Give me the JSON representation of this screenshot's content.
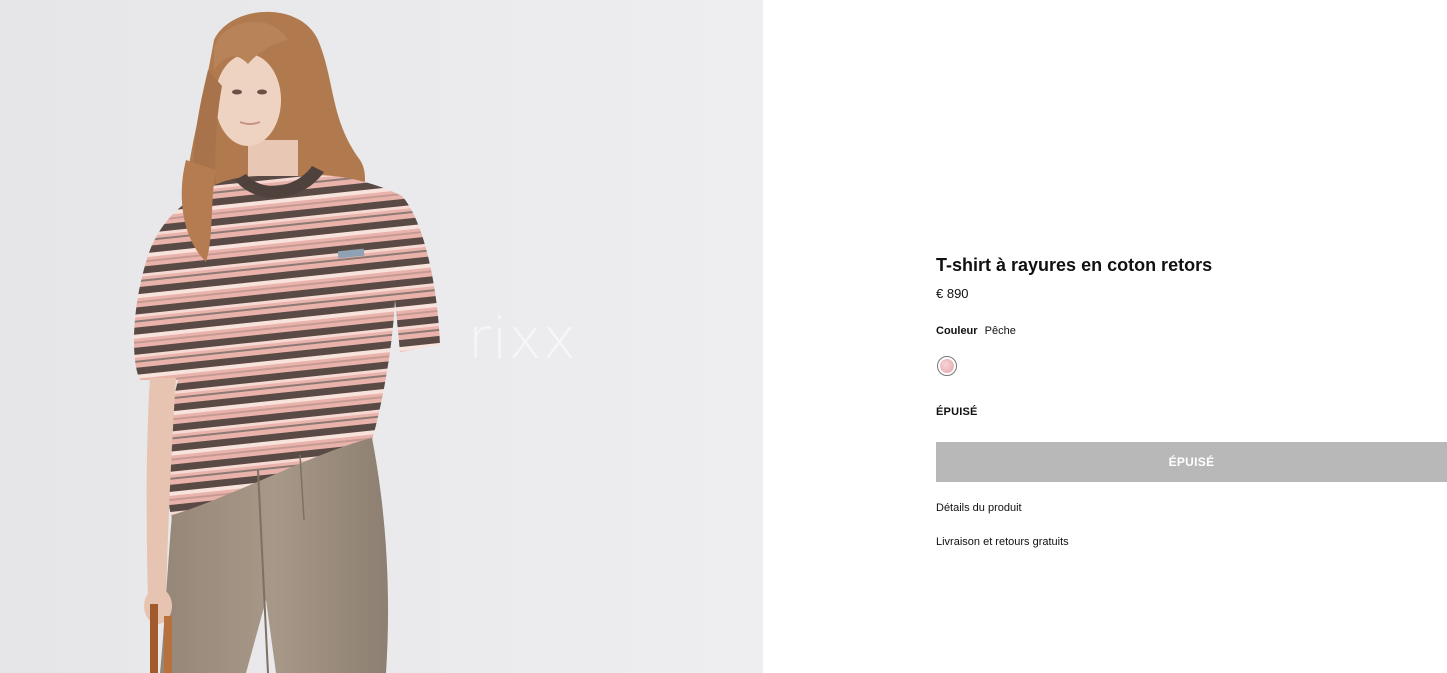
{
  "image": {
    "alt_watermark": "rixx"
  },
  "product": {
    "title": "T-shirt à rayures en coton retors",
    "price": "€ 890",
    "color": {
      "label": "Couleur",
      "value": "Pêche",
      "swatch_color": "#eab3b8"
    },
    "stock_status": "ÉPUISÉ",
    "button_label": "ÉPUISÉ",
    "button_color": "#b8b8b8"
  },
  "links": {
    "details": "Détails du produit",
    "delivery": "Livraison et retours gratuits"
  }
}
